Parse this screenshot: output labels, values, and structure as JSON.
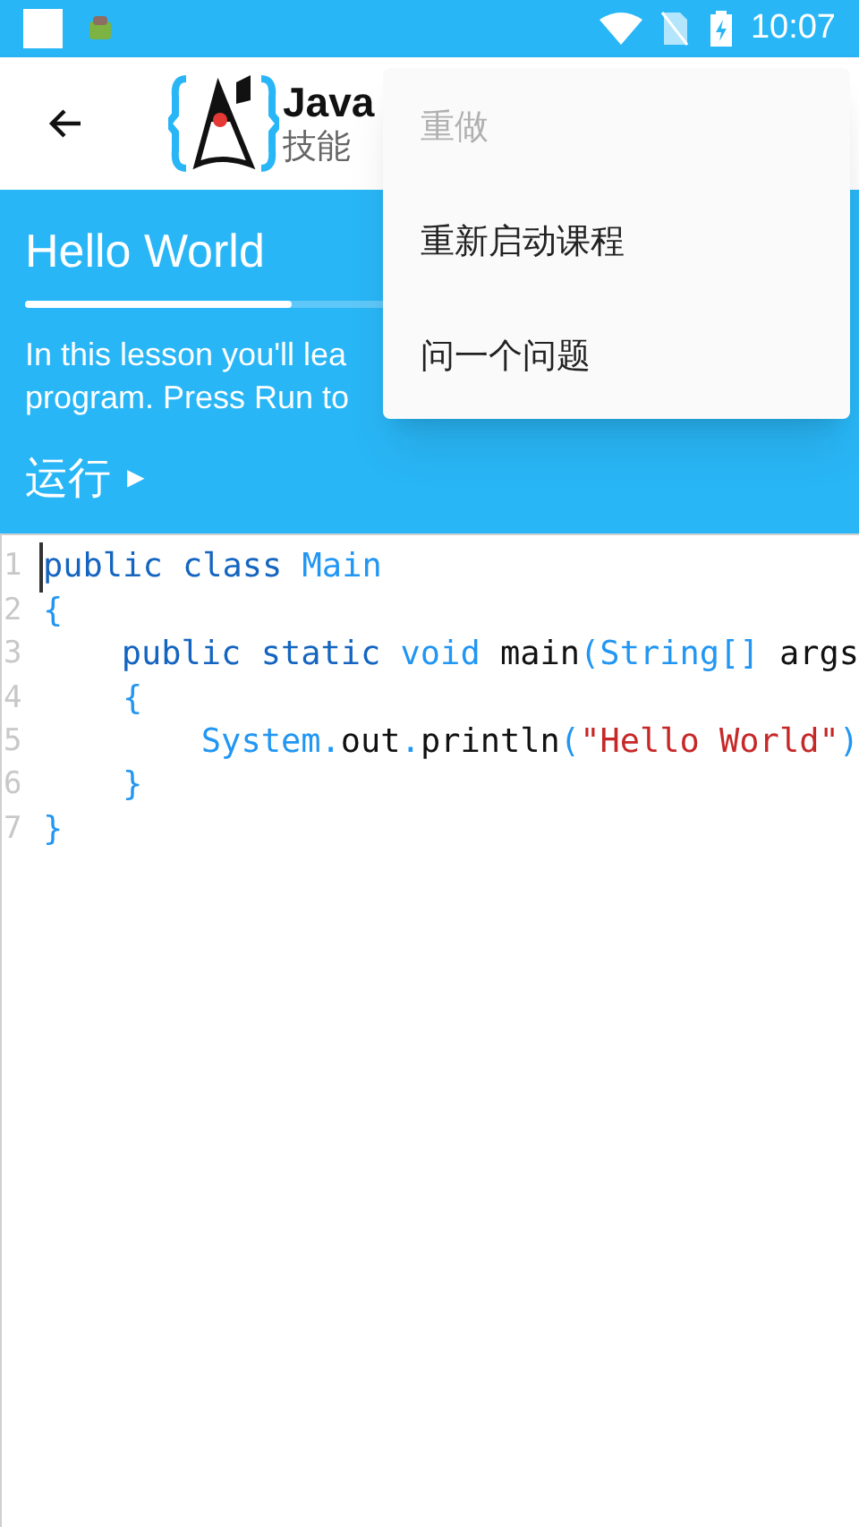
{
  "status_bar": {
    "time": "10:07"
  },
  "app_bar": {
    "title": "Java",
    "subtitle": "技能"
  },
  "lesson": {
    "title": "Hello World",
    "level": 0.33,
    "description": [
      "In this lesson you'll lea",
      "program. Press Run to"
    ],
    "run_label": "运行",
    "run_icon": "►"
  },
  "editor": {
    "lines": [
      {
        "number": "1",
        "tokens": [
          {
            "kind": "keyword",
            "text": "public class "
          },
          {
            "kind": "type",
            "text": "Main"
          }
        ]
      },
      {
        "number": "2",
        "tokens": [
          {
            "kind": "type",
            "text": "{"
          }
        ]
      },
      {
        "number": "3",
        "tokens": [
          {
            "kind": "keyword",
            "text": "    public static "
          },
          {
            "kind": "type",
            "text": "void "
          },
          {
            "kind": "plain",
            "text": "main"
          },
          {
            "kind": "type",
            "text": "(String[] "
          },
          {
            "kind": "plain",
            "text": "args"
          }
        ]
      },
      {
        "number": "4",
        "tokens": [
          {
            "kind": "type",
            "text": "    {"
          }
        ]
      },
      {
        "number": "5",
        "tokens": [
          {
            "kind": "type",
            "text": "        System."
          },
          {
            "kind": "plain",
            "text": "out"
          },
          {
            "kind": "type",
            "text": "."
          },
          {
            "kind": "plain",
            "text": "println"
          },
          {
            "kind": "type",
            "text": "("
          },
          {
            "kind": "string",
            "text": "\"Hello World\""
          },
          {
            "kind": "type",
            "text": ")"
          }
        ]
      },
      {
        "number": "6",
        "tokens": [
          {
            "kind": "type",
            "text": "    }"
          }
        ]
      },
      {
        "number": "7",
        "tokens": [
          {
            "kind": "type",
            "text": "}"
          }
        ]
      }
    ]
  },
  "menu": {
    "items": [
      {
        "label": "重做",
        "disabled": true
      },
      {
        "label": "重新启动课程",
        "disabled": false
      },
      {
        "label": "问一个问题",
        "disabled": false
      }
    ]
  }
}
